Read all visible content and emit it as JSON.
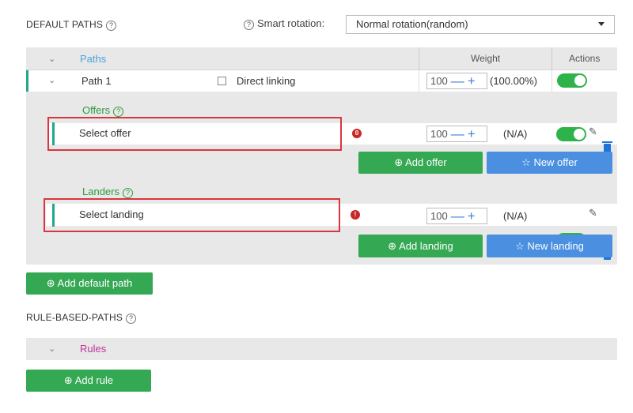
{
  "default_paths": {
    "title": "DEFAULT PATHS",
    "help_icon": "question-circle-icon",
    "smart_rotation_label": "Smart rotation:",
    "smart_rotation_value": "Normal rotation(random)",
    "header": {
      "paths": "Paths",
      "weight": "Weight",
      "actions": "Actions"
    },
    "path": {
      "name": "Path 1",
      "direct_linking_label": "Direct linking",
      "weight": "100",
      "weight_pct": "(100.00%)",
      "offers_label": "Offers",
      "offer_select": "Select offer",
      "offer_weight": "100",
      "offer_pct": "(N/A)",
      "offer_error": "0",
      "add_offer": "Add offer",
      "new_offer": "New offer",
      "landers_label": "Landers",
      "landing_select": "Select landing",
      "landing_weight": "100",
      "landing_pct": "(N/A)",
      "landing_error": "!",
      "add_landing": "Add landing",
      "new_landing": "New landing"
    },
    "add_default_path": "Add default path"
  },
  "rule_paths": {
    "title": "RULE-BASED-PATHS",
    "rules_label": "Rules",
    "add_rule": "Add rule"
  },
  "colors": {
    "accent_green": "#34a853",
    "accent_blue": "#4a8fe0",
    "highlight_red": "#d9363e",
    "rules_magenta": "#c0359a",
    "paths_blue": "#4aa3df"
  }
}
